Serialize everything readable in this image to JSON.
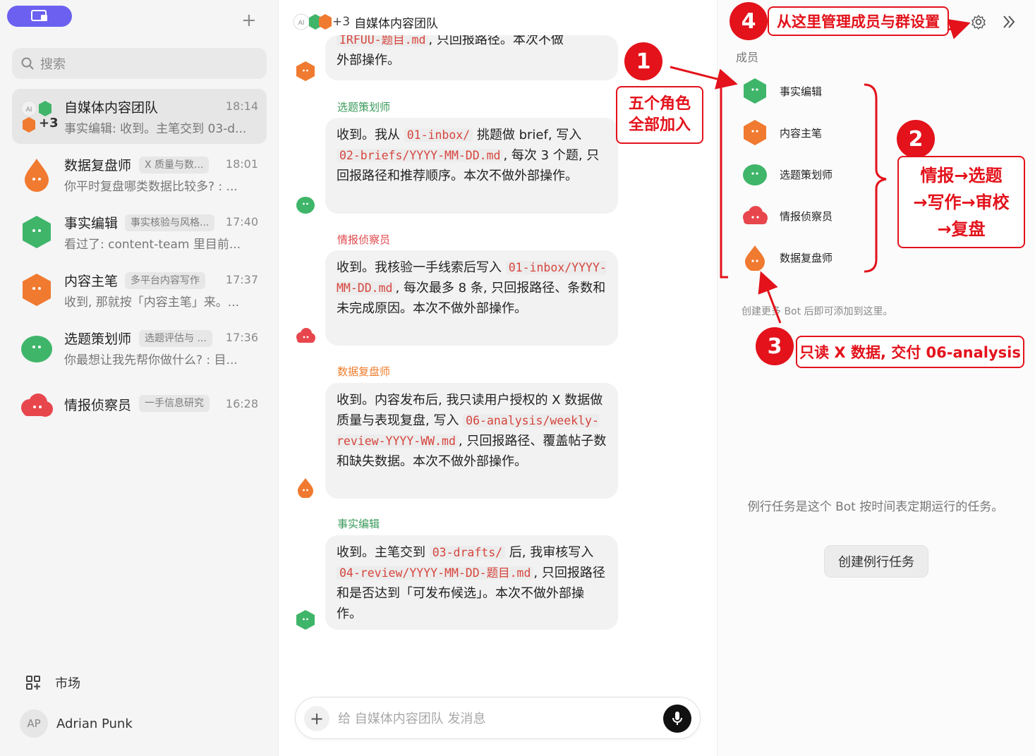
{
  "sidebar": {
    "search_placeholder": "搜索",
    "chats": [
      {
        "name": "自媒体内容团队",
        "tag": "",
        "time": "18:14",
        "preview": "事实编辑: 收到。主笔交到 03-d...",
        "extra": "+3"
      },
      {
        "name": "数据复盘师",
        "tag": "X 质量与数...",
        "time": "18:01",
        "preview": "你平时复盘哪类数据比较多? :  ..."
      },
      {
        "name": "事实编辑",
        "tag": "事实核验与风格...",
        "time": "17:40",
        "preview": "看过了: content-team 里目前..."
      },
      {
        "name": "内容主笔",
        "tag": "多平台内容写作",
        "time": "17:37",
        "preview": "收到, 那就按「内容主笔」来。..."
      },
      {
        "name": "选题策划师",
        "tag": "选题评估与 ...",
        "time": "17:36",
        "preview": "你最想让我先帮你做什么? : 目..."
      },
      {
        "name": "情报侦察员",
        "tag": "一手信息研究",
        "time": "16:28",
        "preview": ""
      }
    ],
    "market_label": "市场",
    "user_initials": "AP",
    "user_name": "Adrian Punk"
  },
  "chat": {
    "header_extra": "+3",
    "header_title": "自媒体内容团队",
    "top_fragment_code": "IRFUU-题目.md",
    "top_fragment_text": ", 只回报路径。本次不做",
    "top_fragment_line2": "外部操作。",
    "messages": [
      {
        "sender": "选题策划师",
        "sender_color": "#3a9a5b",
        "t1": "收到。我从 ",
        "c1": "01-inbox/",
        "t2": " 挑题做 brief, 写入 ",
        "c2": "02-briefs/YYYY-MM-DD.md",
        "t3": ", 每次 3 个题, 只回报路径和推荐顺序。本次不做外部操作。"
      },
      {
        "sender": "情报侦察员",
        "sender_color": "#e0484e",
        "t1": "收到。我核验一手线索后写入 ",
        "c1": "01-inbox/YYYY-MM-DD.md",
        "t2": ", 每次最多 8 条, 只回报路径、条数和未完成原因。本次不做外部操作。"
      },
      {
        "sender": "数据复盘师",
        "sender_color": "#ee7d2c",
        "t1": "收到。内容发布后, 我只读用户授权的 X 数据做质量与表现复盘, 写入 ",
        "c1": "06-analysis/weekly-review-YYYY-WW.md",
        "t2": ", 只回报路径、覆盖帖子数和缺失数据。本次不做外部操作。"
      },
      {
        "sender": "事实编辑",
        "sender_color": "#3a9a5b",
        "t1": "收到。主笔交到 ",
        "c1": "03-drafts/",
        "t2": " 后, 我审核写入 ",
        "c2": "04-review/YYYY-MM-DD-题目.md",
        "t3": ", 只回报路径和是否达到「可发布候选」。本次不做外部操作。"
      }
    ],
    "composer_placeholder": "给 自媒体内容团队 发消息"
  },
  "panel": {
    "members_label": "成员",
    "members": [
      "事实编辑",
      "内容主笔",
      "选题策划师",
      "情报侦察员",
      "数据复盘师"
    ],
    "hint": "创建更多 Bot 后即可添加到这里。",
    "routine_text": "例行任务是这个 Bot 按时间表定期运行的任务。",
    "routine_button": "创建例行任务"
  },
  "annotations": {
    "badge1": "1",
    "badge2": "2",
    "badge3": "3",
    "badge4": "4",
    "box1": "五个角色 全部加入",
    "box2_line1": "情报→选题",
    "box2_line2": "→写作→审校",
    "box2_line3": "→复盘",
    "box3": "只读 X 数据, 交付 06-analysis",
    "box4": "从这里管理成员与群设置"
  },
  "colors": {
    "accent": "#6b60f0",
    "annotation_red": "#e3121b",
    "green_bot": "#3fb56a",
    "orange_bot": "#f07a30",
    "red_bot": "#e8464d"
  }
}
